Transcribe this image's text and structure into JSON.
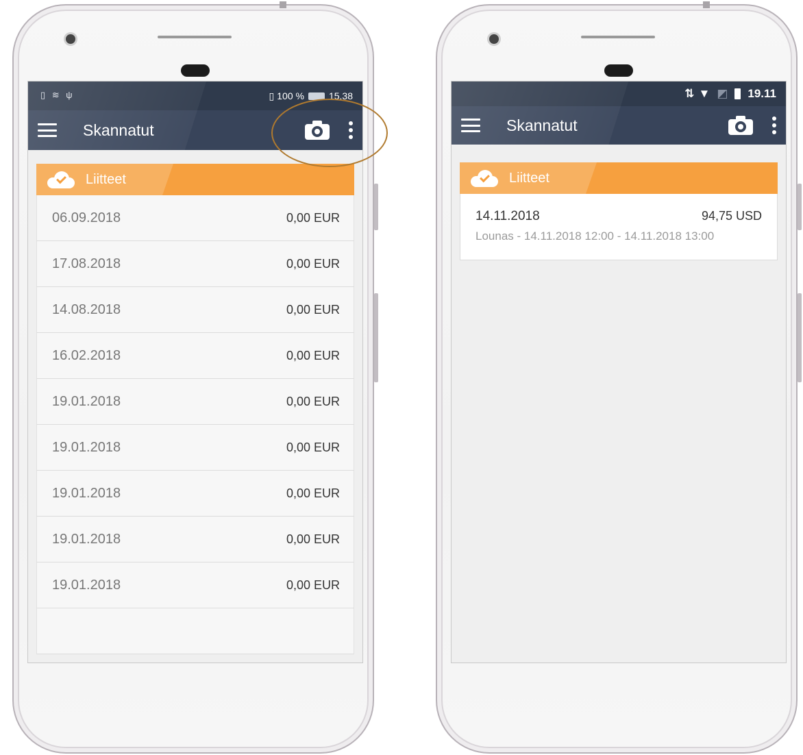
{
  "left_phone": {
    "status_right": "100 %",
    "status_time": "15.38",
    "app_title": "Skannatut",
    "section_title": "Liitteet",
    "rows": [
      {
        "date": "06.09.2018",
        "amount": "0,00 EUR"
      },
      {
        "date": "17.08.2018",
        "amount": "0,00 EUR"
      },
      {
        "date": "14.08.2018",
        "amount": "0,00 EUR"
      },
      {
        "date": "16.02.2018",
        "amount": "0,00 EUR"
      },
      {
        "date": "19.01.2018",
        "amount": "0,00 EUR"
      },
      {
        "date": "19.01.2018",
        "amount": "0,00 EUR"
      },
      {
        "date": "19.01.2018",
        "amount": "0,00 EUR"
      },
      {
        "date": "19.01.2018",
        "amount": "0,00 EUR"
      },
      {
        "date": "19.01.2018",
        "amount": "0,00 EUR"
      },
      {
        "date": "",
        "amount": ""
      }
    ]
  },
  "right_phone": {
    "status_time": "19.11",
    "app_title": "Skannatut",
    "section_title": "Liitteet",
    "card": {
      "date": "14.11.2018",
      "amount": "94,75 USD",
      "detail": "Lounas - 14.11.2018 12:00 - 14.11.2018 13:00"
    }
  },
  "icons": {
    "menu": "hamburger-icon",
    "camera": "camera-icon",
    "more": "more-vert-icon",
    "cloud": "cloud-check-icon"
  },
  "colors": {
    "appbar": "#38445a",
    "statusbar": "#2f3a4c",
    "section": "#f6a03f",
    "highlight": "#b07a2e"
  }
}
